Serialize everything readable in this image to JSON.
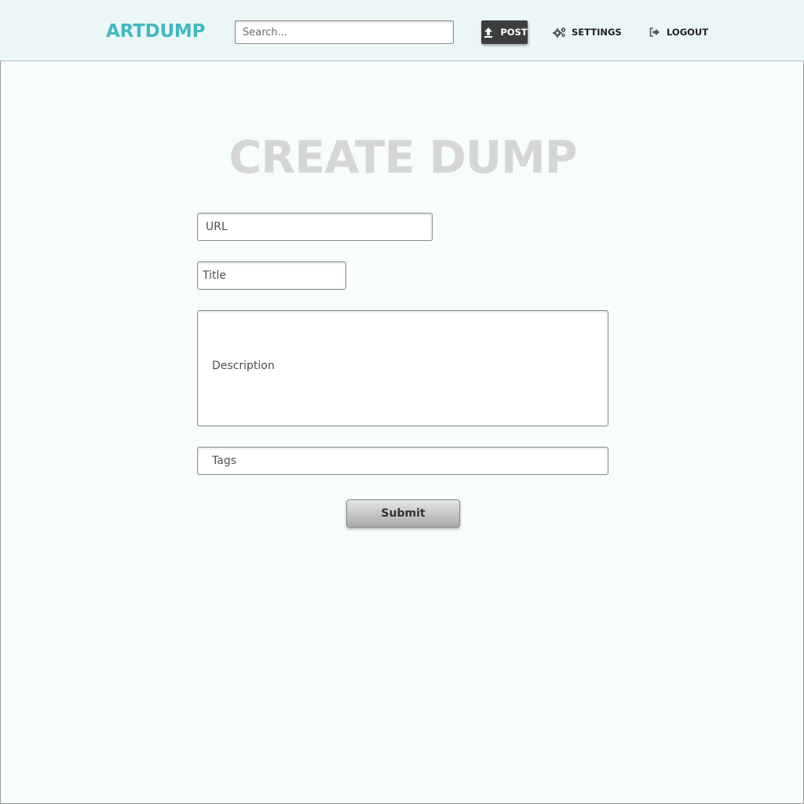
{
  "header": {
    "logo": "ARTDUMP",
    "search_placeholder": "Search...",
    "nav": {
      "post_label": "POST",
      "settings_label": "SETTINGS",
      "logout_label": "LOGOUT"
    },
    "icons": {
      "post": "upload-icon",
      "settings": "gears-icon",
      "logout": "logout-icon"
    }
  },
  "main": {
    "title": "CREATE DUMP",
    "form": {
      "url_placeholder": "URL",
      "title_placeholder": "Title",
      "description_placeholder": "Description",
      "tags_placeholder": "Tags",
      "submit_label": "Submit"
    }
  },
  "colors": {
    "accent": "#44b8c2",
    "header_bg": "#ebf7f7",
    "page_bg": "#f7fcfc",
    "post_button_bg": "#3b3d3e",
    "title_color": "#d6d6d6"
  }
}
